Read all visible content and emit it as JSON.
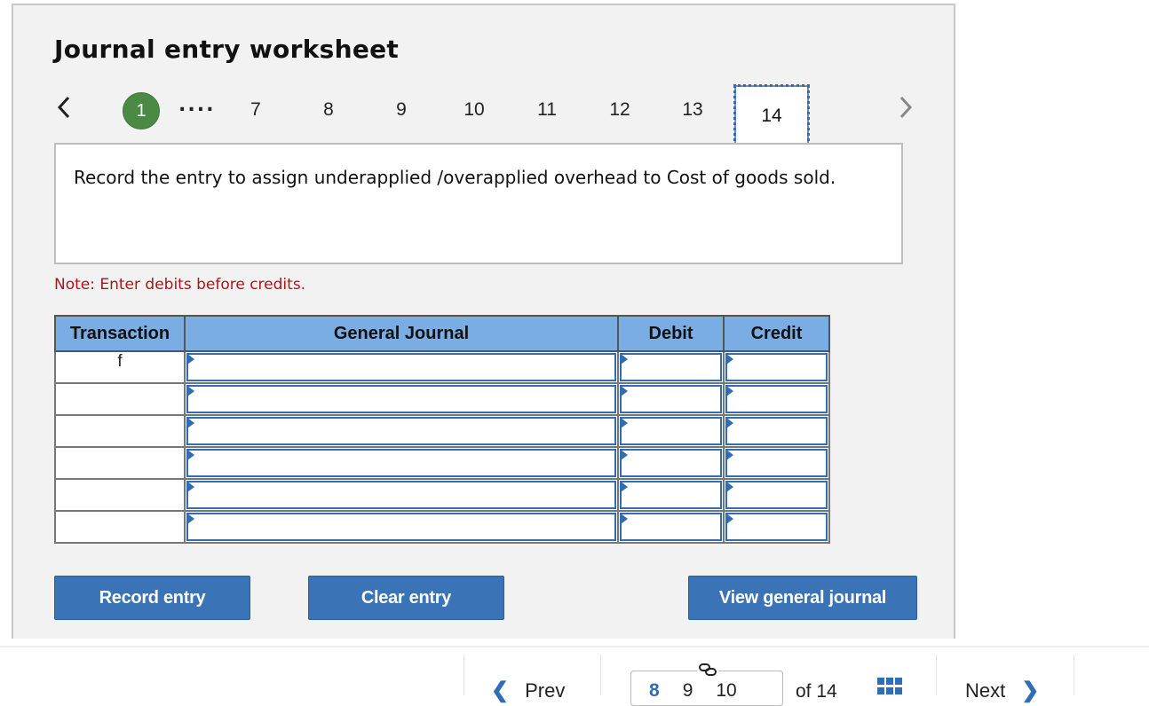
{
  "worksheet": {
    "title": "Journal entry worksheet",
    "pager": {
      "prev_icon": "chevron-left-icon",
      "next_icon": "chevron-right-icon",
      "first": "1",
      "ellipsis": "....",
      "pages": [
        "7",
        "8",
        "9",
        "10",
        "11",
        "12",
        "13"
      ],
      "current": "14"
    },
    "question": "Record the entry to assign underapplied /overapplied overhead to Cost of goods sold.",
    "note": "Note: Enter debits before credits.",
    "table": {
      "headers": [
        "Transaction",
        "General Journal",
        "Debit",
        "Credit"
      ],
      "rows": [
        {
          "transaction": "f",
          "account": "",
          "debit": "",
          "credit": ""
        },
        {
          "transaction": "",
          "account": "",
          "debit": "",
          "credit": ""
        },
        {
          "transaction": "",
          "account": "",
          "debit": "",
          "credit": ""
        },
        {
          "transaction": "",
          "account": "",
          "debit": "",
          "credit": ""
        },
        {
          "transaction": "",
          "account": "",
          "debit": "",
          "credit": ""
        },
        {
          "transaction": "",
          "account": "",
          "debit": "",
          "credit": ""
        }
      ]
    },
    "buttons": {
      "record": "Record entry",
      "clear": "Clear entry",
      "view": "View general journal"
    }
  },
  "bottom_nav": {
    "prev_label": "Prev",
    "next_label": "Next",
    "pages": [
      "8",
      "9",
      "10"
    ],
    "current_page": "8",
    "of_label": "of 14",
    "link_icon": "link-icon",
    "grid_icon": "grid-icon"
  },
  "colors": {
    "accent": "#3a74b7",
    "header_blue": "#7aade3",
    "success_green": "#4a8a45",
    "note_red": "#b0121b"
  }
}
